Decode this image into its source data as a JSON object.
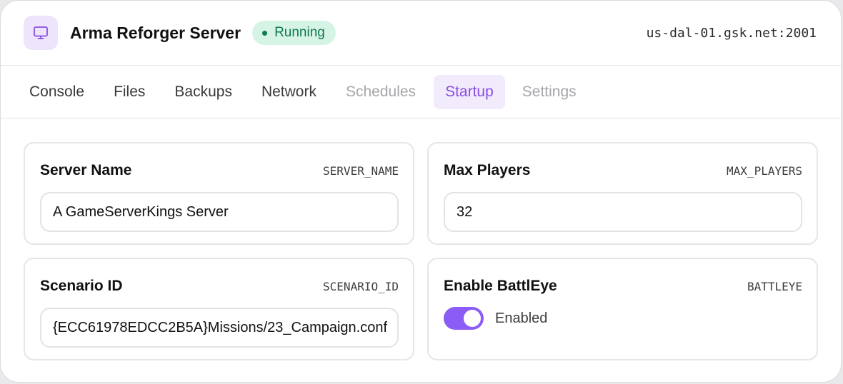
{
  "header": {
    "title": "Arma Reforger Server",
    "status": "Running",
    "host": "us-dal-01.gsk.net:2001",
    "icon": "monitor-icon"
  },
  "tabs": [
    {
      "label": "Console",
      "state": "default"
    },
    {
      "label": "Files",
      "state": "default"
    },
    {
      "label": "Backups",
      "state": "default"
    },
    {
      "label": "Network",
      "state": "default"
    },
    {
      "label": "Schedules",
      "state": "muted"
    },
    {
      "label": "Startup",
      "state": "active"
    },
    {
      "label": "Settings",
      "state": "muted"
    }
  ],
  "fields": {
    "server_name": {
      "label": "Server Name",
      "env": "SERVER_NAME",
      "value": "A GameServerKings Server"
    },
    "max_players": {
      "label": "Max Players",
      "env": "MAX_PLAYERS",
      "value": "32"
    },
    "scenario_id": {
      "label": "Scenario ID",
      "env": "SCENARIO_ID",
      "value": "{ECC61978EDCC2B5A}Missions/23_Campaign.conf"
    },
    "battleye": {
      "label": "Enable BattlEye",
      "env": "BATTLEYE",
      "toggle_label": "Enabled",
      "enabled": true
    }
  },
  "colors": {
    "accent": "#8b5cf6",
    "status_bg": "#d6f4e6",
    "status_text": "#117a4c"
  }
}
